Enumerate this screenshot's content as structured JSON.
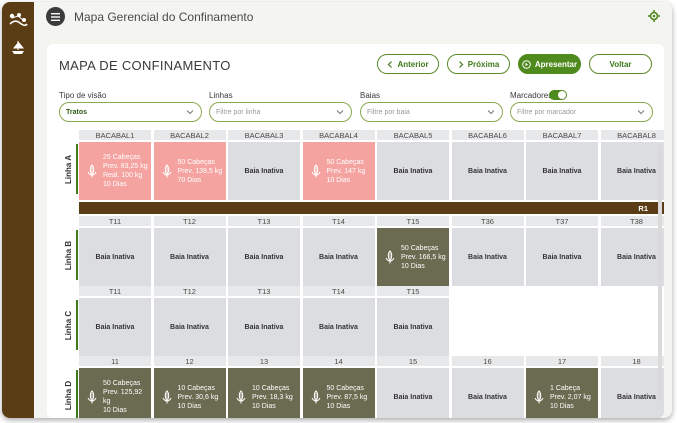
{
  "app": {
    "title": "Mapa Gerencial do Confinamento"
  },
  "page": {
    "title": "MAPA DE CONFINAMENTO"
  },
  "buttons": {
    "previous": "Anterior",
    "next": "Próxima",
    "present": "Apresentar",
    "back": "Voltar"
  },
  "filters": {
    "view_type": {
      "label": "Tipo de visão",
      "value": "Tratos"
    },
    "lines": {
      "label": "Linhas",
      "placeholder": "Filtre por linha"
    },
    "pens": {
      "label": "Baias",
      "placeholder": "Filtre por baia"
    },
    "markers": {
      "label": "Marcadores",
      "placeholder": "Filtre por marcador",
      "toggle_on": true
    }
  },
  "colors": {
    "brown": "#5b3d15",
    "green": "#4f8a1f",
    "pink": "#f4a3a0",
    "olive": "#6b6b52"
  },
  "route_label": "R1",
  "lines": [
    {
      "name": "Linha A",
      "pens": [
        {
          "code": "BACABAL1",
          "status": "pink",
          "heads": "25 Cabeças",
          "prev": "Prev. 83,25 kg",
          "real": "Real. 100 kg",
          "days": "10 Dias"
        },
        {
          "code": "BACABAL2",
          "status": "pink",
          "heads": "50 Cabeças",
          "prev": "Prev. 139,5 kg",
          "days": "70 Dias"
        },
        {
          "code": "BACABAL3",
          "status": "inactive",
          "text": "Baia Inativa"
        },
        {
          "code": "BACABAL4",
          "status": "pink",
          "heads": "50 Cabeças",
          "prev": "Prev. 147 kg",
          "days": "10 Dias"
        },
        {
          "code": "BACABAL5",
          "status": "inactive",
          "text": "Baia Inativa"
        },
        {
          "code": "BACABAL6",
          "status": "inactive",
          "text": "Baia Inativa"
        },
        {
          "code": "BACABAL7",
          "status": "inactive",
          "text": "Baia Inativa"
        },
        {
          "code": "BACABAL8",
          "status": "inactive",
          "text": "Baia Inativa"
        }
      ]
    },
    {
      "name": "Linha B",
      "pens": [
        {
          "code": "T11",
          "status": "inactive",
          "text": "Baia Inativa"
        },
        {
          "code": "T12",
          "status": "inactive",
          "text": "Baia Inativa"
        },
        {
          "code": "T13",
          "status": "inactive",
          "text": "Baia Inativa"
        },
        {
          "code": "T14",
          "status": "inactive",
          "text": "Baia Inativa"
        },
        {
          "code": "T15",
          "status": "olive",
          "heads": "50 Cabeças",
          "prev": "Prev. 166,5 kg",
          "days": "10 Dias"
        },
        {
          "code": "T36",
          "status": "inactive",
          "text": "Baia Inativa"
        },
        {
          "code": "T37",
          "status": "inactive",
          "text": "Baia Inativa"
        },
        {
          "code": "T38",
          "status": "inactive",
          "text": "Baia Inativa"
        }
      ]
    },
    {
      "name": "Linha C",
      "pens": [
        {
          "code": "T11",
          "status": "inactive",
          "text": "Baia Inativa"
        },
        {
          "code": "T12",
          "status": "inactive",
          "text": "Baia Inativa"
        },
        {
          "code": "T13",
          "status": "inactive",
          "text": "Baia Inativa"
        },
        {
          "code": "T14",
          "status": "inactive",
          "text": "Baia Inativa"
        },
        {
          "code": "T15",
          "status": "inactive",
          "text": "Baia Inativa"
        }
      ]
    },
    {
      "name": "Linha D",
      "pens": [
        {
          "code": "11",
          "status": "olive",
          "heads": "50 Cabeças",
          "prev": "Prev. 125,92 kg",
          "days": "10 Dias"
        },
        {
          "code": "12",
          "status": "olive",
          "heads": "10 Cabeças",
          "prev": "Prev. 30,6 kg",
          "days": "10 Dias"
        },
        {
          "code": "13",
          "status": "olive",
          "heads": "10 Cabeças",
          "prev": "Prev. 18,3 kg",
          "days": "10 Dias"
        },
        {
          "code": "14",
          "status": "olive",
          "heads": "50 Cabeças",
          "prev": "Prev. 87,5 kg",
          "days": "10 Dias"
        },
        {
          "code": "15",
          "status": "inactive",
          "text": "Baia Inativa"
        },
        {
          "code": "16",
          "status": "inactive",
          "text": "Baia Inativa"
        },
        {
          "code": "17",
          "status": "olive",
          "heads": "1 Cabeça",
          "prev": "Prev. 2,07 kg",
          "days": "10 Dias"
        },
        {
          "code": "18",
          "status": "inactive",
          "text": "Baia Inativa"
        }
      ]
    }
  ]
}
